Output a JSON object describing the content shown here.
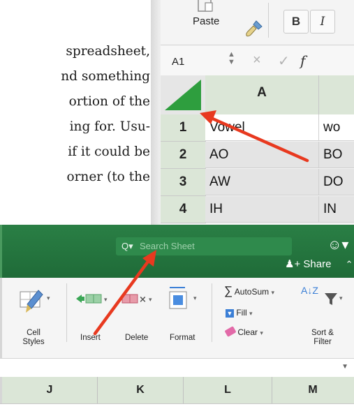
{
  "book_text": {
    "lines": [
      "spreadsheet,",
      "nd something",
      "ortion of the",
      "ing for. Usu-",
      "if it could be",
      "orner (to the"
    ]
  },
  "top_screenshot": {
    "paste_label": "Paste",
    "bold_label": "B",
    "italic_label": "I",
    "name_box": "A1",
    "cancel_glyph": "×",
    "enter_glyph": "✓",
    "fx_glyph": "f",
    "column_headers": [
      "A",
      ""
    ],
    "rows": [
      {
        "num": "1",
        "cells": [
          "Vowel",
          "wo"
        ]
      },
      {
        "num": "2",
        "cells": [
          "AO",
          "BO"
        ]
      },
      {
        "num": "3",
        "cells": [
          "AW",
          "DO"
        ]
      },
      {
        "num": "4",
        "cells": [
          "IH",
          "IN"
        ]
      }
    ]
  },
  "bottom_screenshot": {
    "search_placeholder": "Search Sheet",
    "search_icon_glyph": "Q▾",
    "smiley_glyph": "☺▾",
    "share_label": "Share",
    "share_prefix": "+",
    "collapse_glyph": "⌃",
    "ribbon": {
      "cell_styles": "Cell\nStyles",
      "insert": "Insert",
      "delete": "Delete",
      "format": "Format",
      "autosum": "AutoSum",
      "fill": "Fill",
      "clear": "Clear",
      "sort_filter": "Sort &\nFilter",
      "sigma_glyph": "∑",
      "sort_glyph": "A↓Z"
    },
    "column_headers": [
      "J",
      "K",
      "L",
      "M"
    ]
  },
  "colors": {
    "excel_green": "#217346",
    "arrow_red": "#e8391f",
    "select_all_triangle": "#2e9e3e"
  }
}
